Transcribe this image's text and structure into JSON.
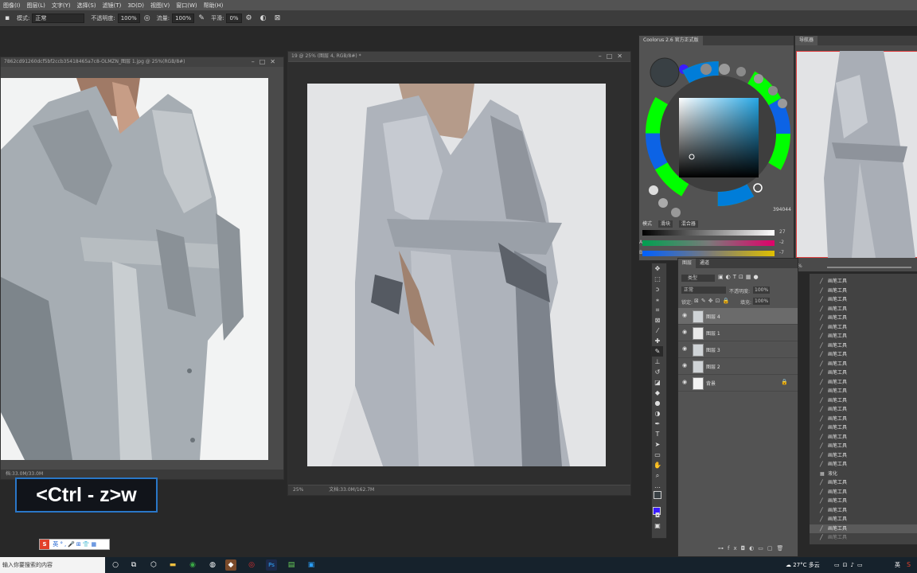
{
  "menu": [
    "图像(I)",
    "图层(L)",
    "文字(Y)",
    "选择(S)",
    "滤镜(T)",
    "3D(D)",
    "视图(V)",
    "窗口(W)",
    "帮助(H)"
  ],
  "options": {
    "mode_label": "模式:",
    "mode_value": "正常",
    "opacity_label": "不透明度:",
    "opacity_value": "100%",
    "flow_label": "流量:",
    "flow_value": "100%",
    "smooth_label": "平滑:",
    "smooth_value": "0%"
  },
  "doc_left": {
    "title": "7862cd91260dcf5bf2ccb35418465a7c8-OLMZN_图层 1.jpg @ 25%(RGB/8#)",
    "status": "档:33.0M/33.0M"
  },
  "doc_main": {
    "title": "19 @ 25% (图层 4, RGB/8#) *",
    "zoom": "25%",
    "status": "文档:33.0M/162.7M"
  },
  "coolorus": {
    "title": "Coolorus 2.6 官方正式版",
    "tabs": [
      "模式",
      "滑块",
      "混合器"
    ],
    "hex": "394044",
    "sliders": [
      {
        "label": "",
        "value": "27"
      },
      {
        "label": "A",
        "value": "-2"
      },
      {
        "label": "B",
        "value": "-7"
      }
    ]
  },
  "navigator": {
    "title": "导航器",
    "zoom": "%"
  },
  "layers": {
    "tabs": [
      "图层",
      "通道"
    ],
    "filter": "类型",
    "blend": "正常",
    "opacity_label": "不透明度:",
    "opacity": "100%",
    "lock_label": "锁定:",
    "fill_label": "填充:",
    "fill": "100%",
    "items": [
      {
        "name": "图层 4",
        "selected": true
      },
      {
        "name": "图层 1",
        "selected": false
      },
      {
        "name": "图层 3",
        "selected": false
      },
      {
        "name": "图层 2",
        "selected": false
      },
      {
        "name": "背景",
        "selected": false,
        "locked": true
      }
    ]
  },
  "history": {
    "items": [
      "画笔工具",
      "画笔工具",
      "画笔工具",
      "画笔工具",
      "画笔工具",
      "画笔工具",
      "画笔工具",
      "画笔工具",
      "画笔工具",
      "画笔工具",
      "画笔工具",
      "画笔工具",
      "画笔工具",
      "画笔工具",
      "画笔工具",
      "画笔工具",
      "画笔工具",
      "画笔工具",
      "画笔工具",
      "画笔工具",
      "画笔工具",
      "液化",
      "画笔工具",
      "画笔工具",
      "画笔工具",
      "画笔工具",
      "画笔工具",
      "画笔工具",
      "画笔工具"
    ]
  },
  "shortcut_overlay": "<Ctrl - z>w",
  "ime_label": "英",
  "taskbar": {
    "search_placeholder": "输入你要搜索的内容",
    "weather": "27°C 多云",
    "ime": "英"
  },
  "colors": {
    "accent": "#2a77c8",
    "ps_bg": "#282828",
    "panel": "#535353"
  }
}
